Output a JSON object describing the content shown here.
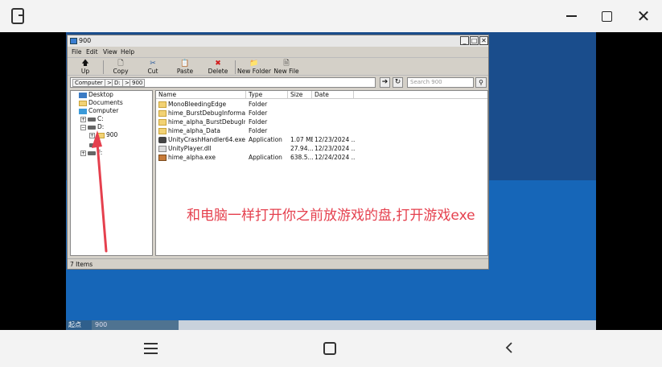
{
  "inner_window": {
    "title": "900",
    "menu": [
      "File",
      "Edit",
      "View",
      "Help"
    ],
    "toolbar": [
      {
        "label": "Up",
        "icon": "up-arrow-icon",
        "glyph": "🡅"
      },
      {
        "label": "Copy",
        "icon": "copy-icon",
        "glyph": "🗋"
      },
      {
        "label": "Cut",
        "icon": "cut-icon",
        "glyph": "✂"
      },
      {
        "label": "Paste",
        "icon": "paste-icon",
        "glyph": "📋"
      },
      {
        "label": "Delete",
        "icon": "delete-icon",
        "glyph": "✖"
      },
      {
        "label": "New Folder",
        "icon": "new-folder-icon",
        "glyph": "📁"
      },
      {
        "label": "New File",
        "icon": "new-file-icon",
        "glyph": "🗎"
      }
    ],
    "address": [
      "Computer",
      ">",
      "D:",
      ">",
      "900"
    ],
    "search_placeholder": "Search 900",
    "tree": [
      {
        "label": "Desktop",
        "kind": "desk"
      },
      {
        "label": "Documents",
        "kind": "docs"
      },
      {
        "label": "Computer",
        "kind": "comp"
      },
      {
        "label": "C:",
        "kind": "drive"
      },
      {
        "label": "D:",
        "kind": "drive"
      },
      {
        "label": "900",
        "kind": "fold"
      },
      {
        "label": "",
        "kind": "drive"
      },
      {
        "label": "F:",
        "kind": "drive"
      }
    ],
    "columns": [
      "Name",
      "Type",
      "Size",
      "Date"
    ],
    "files": [
      {
        "name": "MonoBleedingEdge",
        "type": "Folder",
        "size": "",
        "date": "",
        "icon": "folder"
      },
      {
        "name": "hime_BurstDebugInformati...",
        "type": "Folder",
        "size": "",
        "date": "",
        "icon": "folder"
      },
      {
        "name": "hime_alpha_BurstDebugInf...",
        "type": "Folder",
        "size": "",
        "date": "",
        "icon": "folder"
      },
      {
        "name": "hime_alpha_Data",
        "type": "Folder",
        "size": "",
        "date": "",
        "icon": "folder"
      },
      {
        "name": "UnityCrashHandler64.exe",
        "type": "Application",
        "size": "1.07 MB",
        "date": "12/23/2024 ...",
        "icon": "exe"
      },
      {
        "name": "UnityPlayer.dll",
        "type": "",
        "size": "27.94...",
        "date": "12/23/2024 ...",
        "icon": "dll"
      },
      {
        "name": "hime_alpha.exe",
        "type": "Application",
        "size": "638.5...",
        "date": "12/24/2024 ...",
        "icon": "app"
      }
    ],
    "status": "7 Items"
  },
  "caption": "和电脑一样打开你之前放游戏的盘,打开游戏exe",
  "taskbar": {
    "start": "起点",
    "item": "900"
  },
  "colors": {
    "caption": "#e5404e",
    "arrow": "#e5404e"
  }
}
